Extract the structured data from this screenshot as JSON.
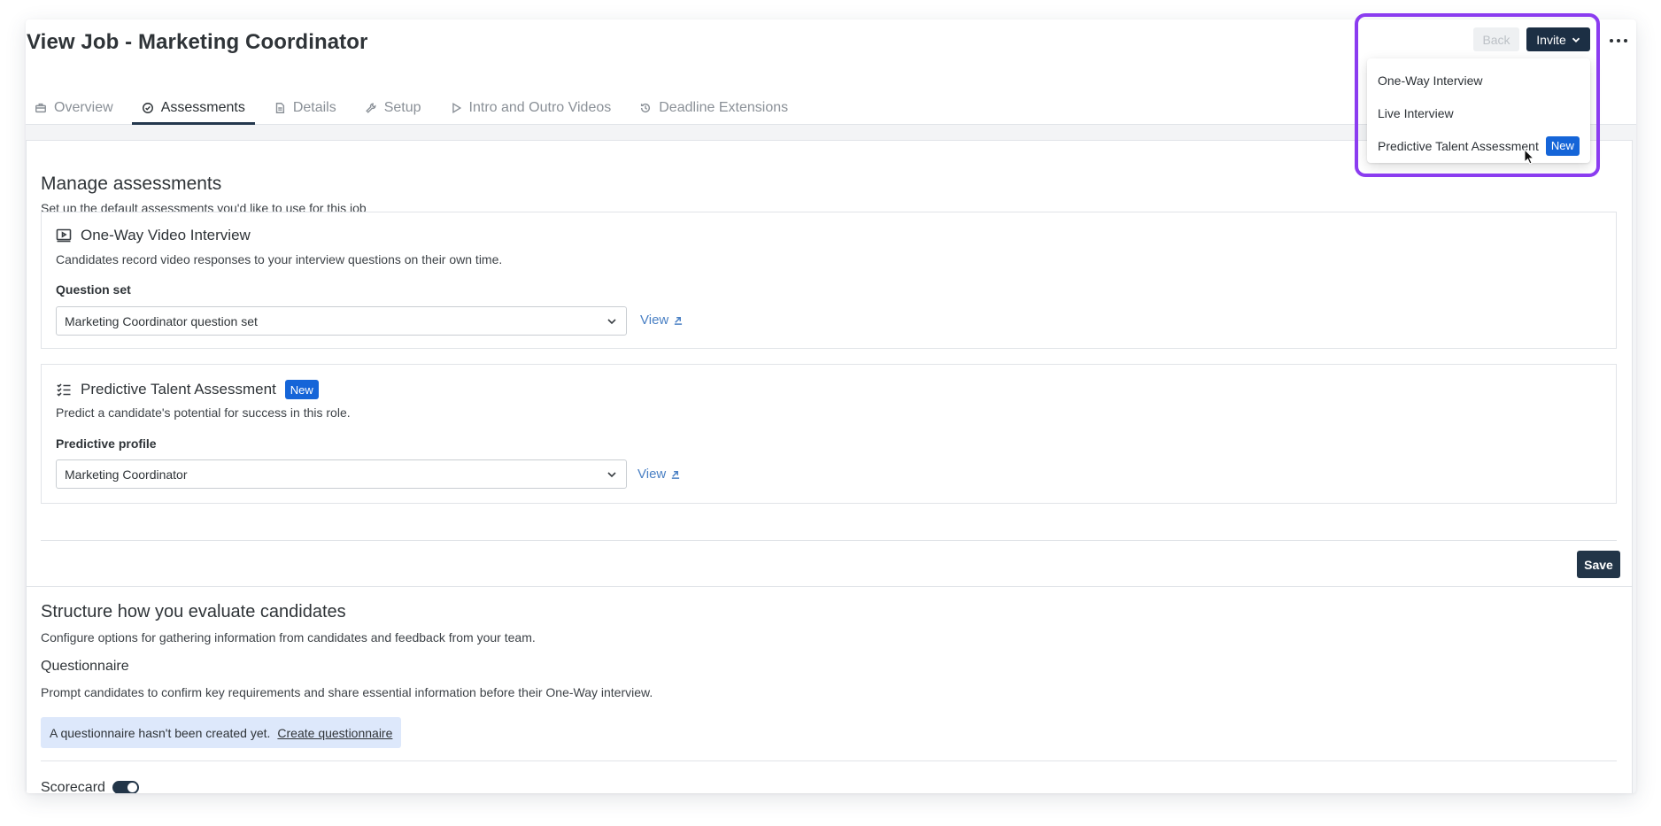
{
  "page": {
    "title": "View Job - Marketing Coordinator"
  },
  "tabs": [
    {
      "label": "Overview",
      "icon": "briefcase-icon"
    },
    {
      "label": "Assessments",
      "icon": "check-circle-icon",
      "active": true
    },
    {
      "label": "Details",
      "icon": "document-icon"
    },
    {
      "label": "Setup",
      "icon": "wrench-icon"
    },
    {
      "label": "Intro and Outro Videos",
      "icon": "play-icon"
    },
    {
      "label": "Deadline Extensions",
      "icon": "history-icon"
    }
  ],
  "actions": {
    "back_label": "Back",
    "invite_label": "Invite",
    "more_icon": "more-horizontal-icon"
  },
  "invite_menu": {
    "items": [
      {
        "label": "One-Way Interview"
      },
      {
        "label": "Live Interview"
      },
      {
        "label": "Predictive Talent Assessment",
        "badge": "New"
      }
    ]
  },
  "manage": {
    "title": "Manage assessments",
    "description": "Set up the default assessments you'd like to use for this job",
    "one_way": {
      "title": "One-Way Video Interview",
      "description": "Candidates record video responses to your interview questions on their own time.",
      "field_label": "Question set",
      "selected": "Marketing Coordinator question set",
      "view_label": "View"
    },
    "predictive": {
      "title": "Predictive Talent Assessment",
      "badge": "New",
      "description": "Predict a candidate's potential for success in this role.",
      "field_label": "Predictive profile",
      "selected": "Marketing Coordinator",
      "view_label": "View"
    },
    "save_label": "Save"
  },
  "structure": {
    "title": "Structure how you evaluate candidates",
    "description": "Configure options for gathering information from candidates and feedback from your team.",
    "questionnaire": {
      "title": "Questionnaire",
      "description": "Prompt candidates to confirm key requirements and share essential information before their One-Way interview.",
      "notice": "A questionnaire hasn't been created yet.",
      "create_link": "Create questionnaire"
    },
    "scorecard": {
      "label": "Scorecard",
      "enabled": true
    }
  },
  "colors": {
    "accent": "#1c2f44",
    "highlight": "#8b3cf0",
    "badge": "#1565d8",
    "link": "#4a80c4"
  }
}
